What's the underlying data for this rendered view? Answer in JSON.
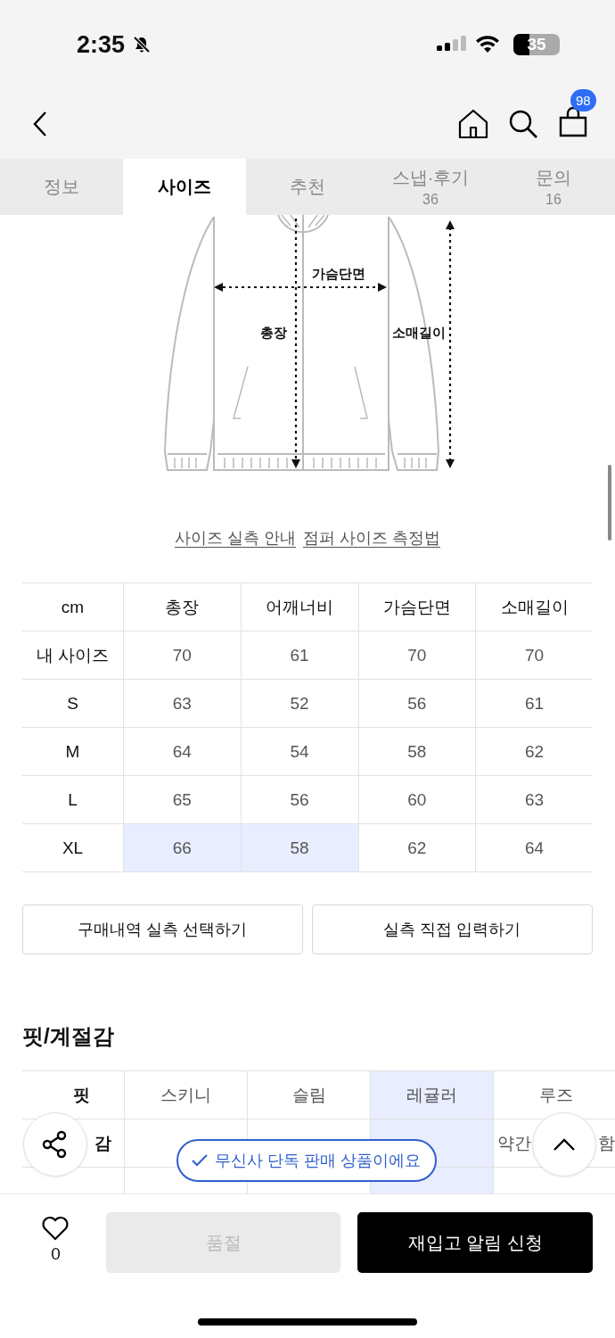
{
  "status_bar": {
    "time": "2:35",
    "battery": "35"
  },
  "header": {
    "cart_badge": "98"
  },
  "tabs": [
    {
      "label": "정보",
      "selected": false
    },
    {
      "label": "사이즈",
      "selected": true
    },
    {
      "label": "추천",
      "selected": false
    },
    {
      "label": "스냅·후기",
      "count": "36",
      "selected": false
    },
    {
      "label": "문의",
      "count": "16",
      "selected": false
    }
  ],
  "size_guide": {
    "diagram_labels": {
      "chest": "가슴단면",
      "length": "총장",
      "sleeve": "소매길이"
    },
    "links": [
      "사이즈 실측 안내",
      "점퍼 사이즈 측정법"
    ],
    "table": {
      "columns": [
        "cm",
        "총장",
        "어깨너비",
        "가슴단면",
        "소매길이"
      ],
      "rows": [
        {
          "cells": [
            {
              "text": "내 사이즈",
              "selected": false
            },
            {
              "text": "70",
              "selected": false
            },
            {
              "text": "61",
              "selected": false
            },
            {
              "text": "70",
              "selected": false
            },
            {
              "text": "70",
              "selected": false
            }
          ]
        },
        {
          "cells": [
            {
              "text": "S",
              "selected": false
            },
            {
              "text": "63",
              "selected": false
            },
            {
              "text": "52",
              "selected": false
            },
            {
              "text": "56",
              "selected": false
            },
            {
              "text": "61",
              "selected": false
            }
          ]
        },
        {
          "cells": [
            {
              "text": "M",
              "selected": false
            },
            {
              "text": "64",
              "selected": false
            },
            {
              "text": "54",
              "selected": false
            },
            {
              "text": "58",
              "selected": false
            },
            {
              "text": "62",
              "selected": false
            }
          ]
        },
        {
          "cells": [
            {
              "text": "L",
              "selected": false
            },
            {
              "text": "65",
              "selected": false
            },
            {
              "text": "56",
              "selected": false
            },
            {
              "text": "60",
              "selected": false
            },
            {
              "text": "63",
              "selected": false
            }
          ]
        },
        {
          "cells": [
            {
              "text": "XL",
              "selected": false
            },
            {
              "text": "66",
              "selected": true
            },
            {
              "text": "58",
              "selected": true
            },
            {
              "text": "62",
              "selected": false
            },
            {
              "text": "64",
              "selected": false
            }
          ]
        }
      ]
    },
    "buttons": [
      "구매내역 실측 선택하기",
      "실측 직접 입력하기"
    ]
  },
  "fit": {
    "title": "핏/계절감",
    "rows": [
      {
        "label": "핏",
        "cells": [
          {
            "parts": [
              "스키니"
            ],
            "selected": false
          },
          {
            "parts": [
              "슬림"
            ],
            "selected": false
          },
          {
            "parts": [
              "레귤러"
            ],
            "selected": true
          },
          {
            "parts": [
              "루즈"
            ],
            "selected": false
          }
        ]
      },
      {
        "label": "감",
        "cells": [
          {
            "selected": false
          },
          {
            "selected": false
          },
          {
            "selected": true
          },
          {
            "parts": [
              "약간",
              "함"
            ],
            "selected": false
          }
        ]
      },
      {
        "cells": [
          {
            "selected": false
          },
          {
            "selected": false
          },
          {
            "selected": true
          },
          {
            "selected": false
          }
        ]
      }
    ]
  },
  "toast": "무신사 단독 판매 상품이에요",
  "bottom_bar": {
    "likes": "0",
    "sold_out": "품절",
    "restock": "재입고 알림 신청"
  }
}
